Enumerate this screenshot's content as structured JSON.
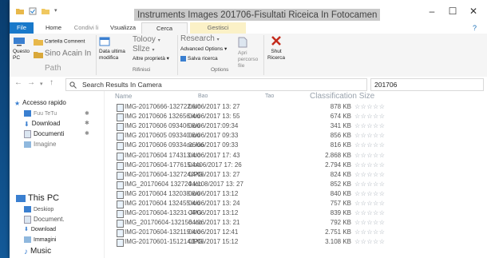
{
  "window": {
    "title": "Instruments Images 201706-Fisultati Riceica In Fotocamen",
    "controls": [
      "–",
      "☐",
      "✕"
    ]
  },
  "tabs": {
    "file": "File",
    "home": "Home",
    "share": "Condivi li",
    "view": "Vsualizza",
    "search": "Cerca",
    "manage": "Gestisci",
    "help": "?"
  },
  "ribbon": {
    "this_pc": "Questo PC",
    "current_folder": "Carteila Comnent",
    "subfolders": "Sino Acain In",
    "path_group": "Path",
    "date_modified": "Data ultima modifica",
    "type": "Tolooy",
    "size": "Sllze",
    "other_props": "Altre proprietà",
    "refine_group": "Rifinisci",
    "recent": "Research",
    "advanced": "Advanced Options",
    "save_search": "Salva ricerca",
    "open_location": "Apri percorso file",
    "options_group": "Options",
    "close_search": "Shut Ricerca"
  },
  "address": {
    "path": "Search Results In Camera",
    "search_value": "201706"
  },
  "navpane": {
    "quick_access": "Accesso rapido",
    "items": [
      "Fuu TeTu",
      "Download",
      "Documenti",
      "Imagine"
    ],
    "this_pc": "This PC",
    "pc_items": [
      "Deskiop",
      "Document.",
      "Download",
      "Immagini",
      "Music"
    ]
  },
  "columns": {
    "name": "Name",
    "date": "Bao",
    "type": "Tao",
    "size": "Classification Size"
  },
  "files": [
    {
      "name": "IMG-20170666-132722.ioo",
      "date": "06/06/2017 13: 27",
      "size": "878 KB"
    },
    {
      "name": "IMG 20170606 132656.ioo",
      "date": "04/06/2017 13: 55",
      "size": "674 KB"
    },
    {
      "name": "IMG 20170606 093406.ioo",
      "date": "06/06/2017:09:34",
      "size": "341 KB"
    },
    {
      "name": "IMG 20170605 093340.ioo",
      "date": "06/06/2017 09:33",
      "size": "856 KB"
    },
    {
      "name": "IMG 20170606 09334oo.ioo",
      "date": "06/06/2017 09:33",
      "size": "816 KB"
    },
    {
      "name": "IMG-20170604 174313.ioo",
      "date": "04/06/2017 17: 43",
      "size": "2.868 KB"
    },
    {
      "name": "IMG-20170604-177615.ioo",
      "date": "04406/2017 17: 26",
      "size": "2.794 KB"
    },
    {
      "name": "IMG-20170604-132724JPG",
      "date": "04/06/2017 13: 27",
      "size": "824 KB"
    },
    {
      "name": "IMG_20170604 132724.ioo",
      "date": "04/108/2017 13: 27",
      "size": "852 KB"
    },
    {
      "name": "IMG 20170604 132038.ioo",
      "date": "06/06/2017 13:12",
      "size": "840 KB"
    },
    {
      "name": "IMG 20170604 132455 ioo",
      "date": "04/06/2017 13: 24",
      "size": "757 KB"
    },
    {
      "name": "IMG-20170604-13231·JPG",
      "date": "04/06/2017 13:12",
      "size": "839 KB"
    },
    {
      "name": "IMG_20170604-132156.ioo",
      "date": "04/06/2017 13: 21",
      "size": "792 KB"
    },
    {
      "name": "IMG-20170604-132119.ioo",
      "date": "04/06/2017 12:41",
      "size": "2.751 KB"
    },
    {
      "name": "IMG-20170601-151214JPG",
      "date": "01/06/2017 15:12",
      "size": "3.108 KB"
    }
  ],
  "stars": "☆☆☆☆☆",
  "colors": {
    "accent": "#1979ca",
    "highlight": "#fff275",
    "manage_tab": "#fbf1c7",
    "close_x": "#c42b1c"
  }
}
